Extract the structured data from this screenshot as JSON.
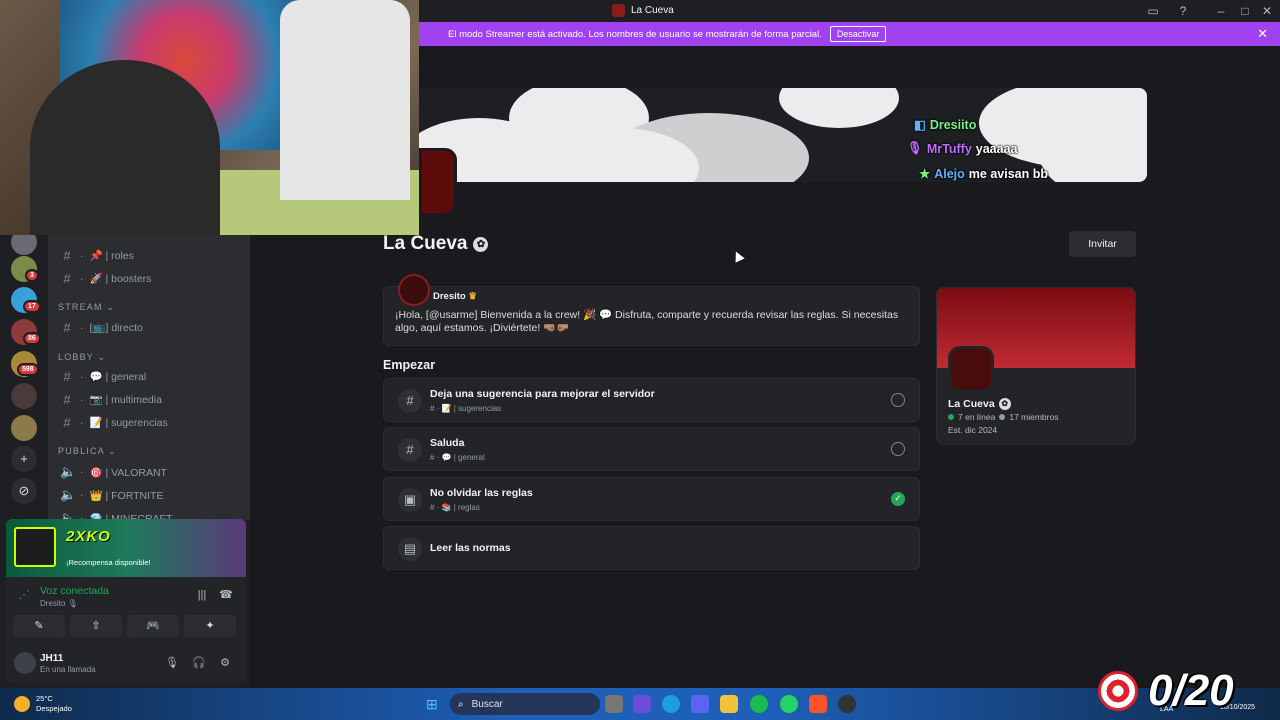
{
  "titlebar": {
    "title": "La Cueva"
  },
  "streamer_banner": {
    "message": "El modo Streamer está activado. Los nombres de usuario se mostrarán de forma parcial.",
    "button": "Desactivar"
  },
  "banner_chat": [
    {
      "user": "Dresiito",
      "text": ""
    },
    {
      "user": "MrTuffy",
      "text": "yaaaaa"
    },
    {
      "user": "Alejo",
      "text": "me avisan bb"
    }
  ],
  "server": {
    "name": "La Cueva",
    "invite": "Invitar"
  },
  "welcome": {
    "author": "Dresito",
    "text": "¡Hola, [@usarme] Bienvenida a la crew! 🎉 💬 Disfruta, comparte y recuerda revisar las reglas. Si necesitas algo, aquí estamos. ¡Diviértete! 🤜🏽🤛🏽"
  },
  "start": {
    "heading": "Empezar",
    "tasks": [
      {
        "title": "Deja una sugerencia para mejorar el servidor",
        "channel": "# · 📝 | sugerencias",
        "done": false,
        "icon": "hash-icon"
      },
      {
        "title": "Saluda",
        "channel": "# · 💬 | general",
        "done": false,
        "icon": "hash-icon"
      },
      {
        "title": "No olvidar las reglas",
        "channel": "# · 📚 | reglas",
        "done": true,
        "icon": "rules-icon"
      },
      {
        "title": "Leer las normas",
        "channel": "",
        "done": null,
        "icon": "book-icon"
      }
    ]
  },
  "side_card": {
    "name": "La Cueva",
    "online": "7 en línea",
    "members": "17 miembros",
    "established": "Est. dic 2024"
  },
  "server_rail": {
    "badges": [
      "3",
      "17",
      "86",
      "598"
    ]
  },
  "channels": {
    "items": [
      {
        "type": "channel",
        "label": "📌 | roles"
      },
      {
        "type": "channel",
        "label": "🚀 | boosters"
      },
      {
        "type": "category",
        "label": "STREAM ⌄"
      },
      {
        "type": "channel",
        "label": "[📺] directo"
      },
      {
        "type": "category",
        "label": "LOBBY ⌄"
      },
      {
        "type": "channel",
        "label": "💬 | general"
      },
      {
        "type": "channel",
        "label": "📷 | multimedia"
      },
      {
        "type": "channel",
        "label": "📝 | sugerencias"
      },
      {
        "type": "category",
        "label": "PUBLICA ⌄"
      },
      {
        "type": "voice",
        "label": "🎯 | VALORANT"
      },
      {
        "type": "voice",
        "label": "👑 | FORTNITE"
      },
      {
        "type": "voice",
        "label": "💎 | MINECRAFT"
      }
    ]
  },
  "voice_panel": {
    "brand": "2XKO",
    "reward": "¡Recompensa disponible!",
    "status": "Voz conectada",
    "channel_user": "Dresito 🎙",
    "user_name": "JH11",
    "user_status": "En una llamada"
  },
  "overlay": {
    "goal": "0/20"
  },
  "taskbar": {
    "temp": "25°C",
    "weather": "Despejado",
    "search_placeholder": "Buscar",
    "lang": "LAA",
    "date": "10/10/2025"
  }
}
